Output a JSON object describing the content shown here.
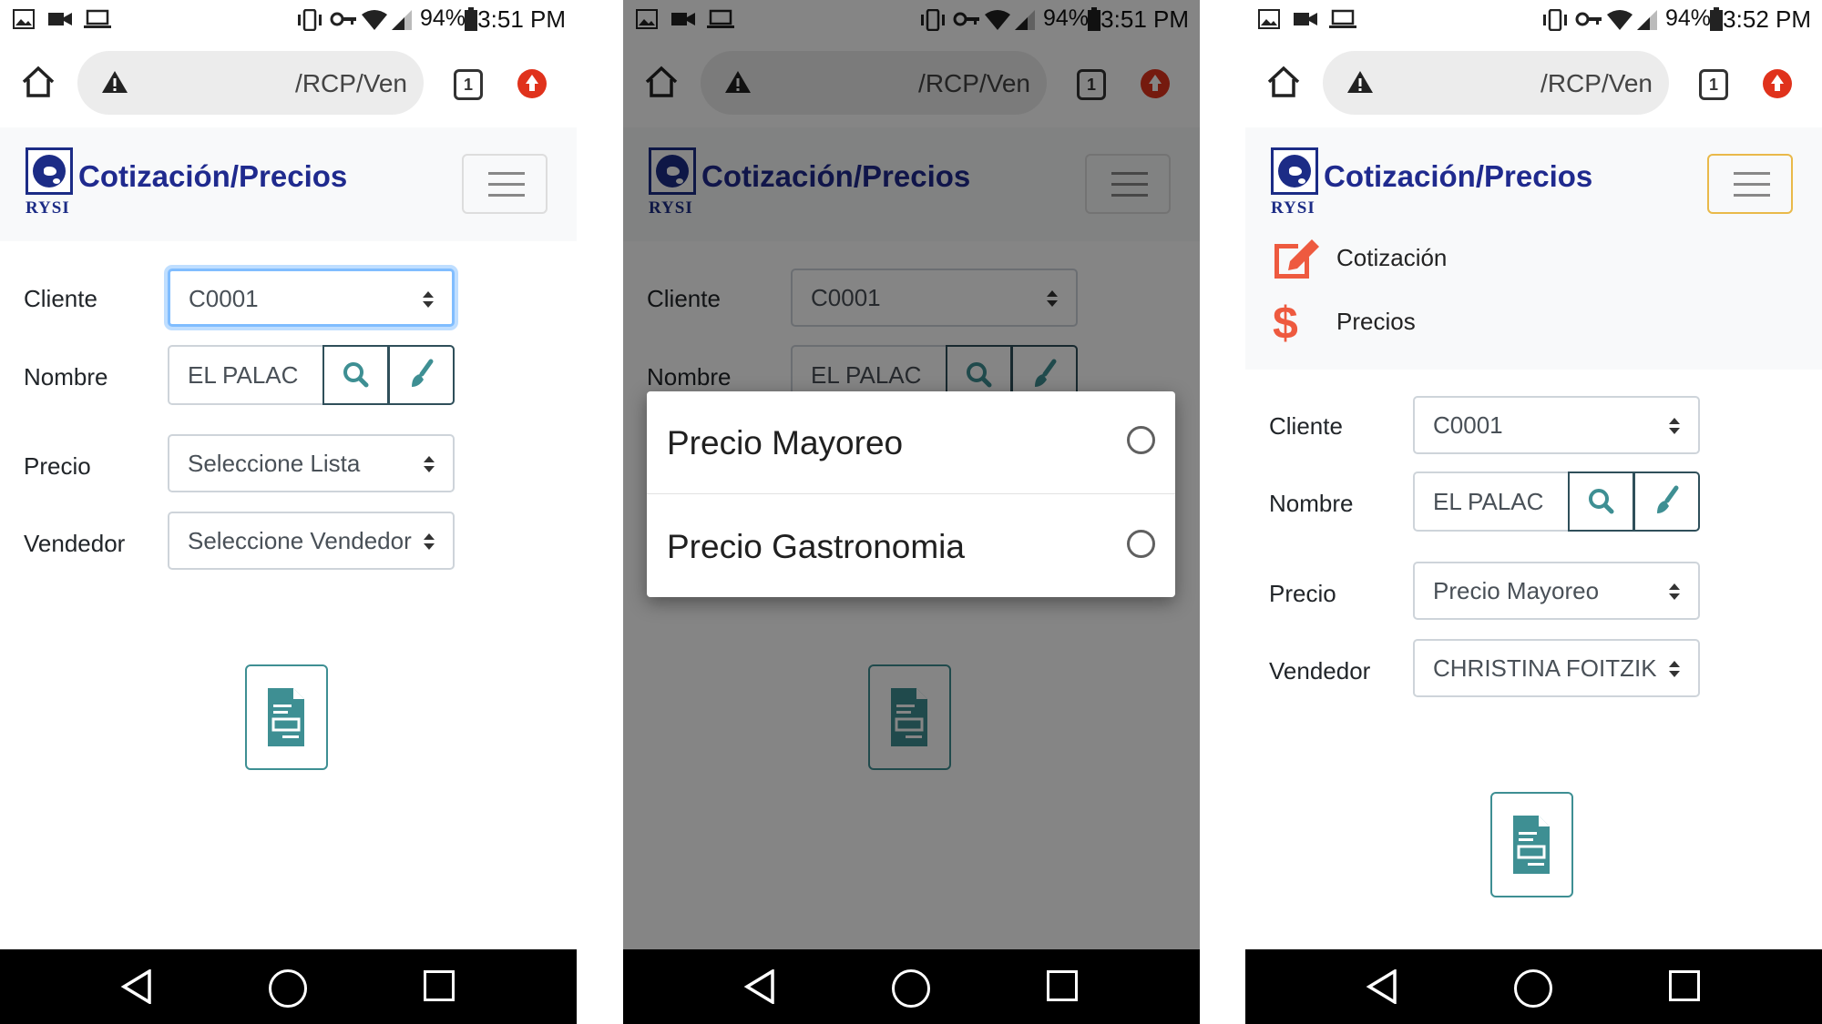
{
  "status_bar": [
    {
      "battery": "94%",
      "time": "3:51 PM"
    },
    {
      "battery": "94%",
      "time": "3:51 PM"
    },
    {
      "battery": "94%",
      "time": "3:52 PM"
    }
  ],
  "browser": {
    "url_text": "/RCP/Ven",
    "tab_count": "1"
  },
  "app": {
    "logo_text": "RYSI",
    "brand_title": "Cotización/Precios"
  },
  "menu": {
    "items": [
      {
        "label": "Cotización",
        "icon": "edit-icon",
        "color": "#ee5a3f"
      },
      {
        "label": "Precios",
        "icon": "dollar-icon",
        "color": "#ee5a3f"
      }
    ]
  },
  "form": {
    "labels": {
      "cliente": "Cliente",
      "nombre": "Nombre",
      "precio": "Precio",
      "vendedor": "Vendedor"
    },
    "before": {
      "cliente": "C0001",
      "nombre": "EL PALAC",
      "precio": "Seleccione Lista",
      "vendedor": "Seleccione Vendedor"
    },
    "after": {
      "cliente": "C0001",
      "nombre": "EL PALAC",
      "precio": "Precio Mayoreo",
      "vendedor": "CHRISTINA FOITZIK"
    }
  },
  "dialog": {
    "options": [
      "Precio Mayoreo",
      "Precio Gastronomia"
    ]
  },
  "colors": {
    "brand": "#1f2a8e",
    "accent_teal": "#3e8f93",
    "menu_icon": "#ee5a3f",
    "focus_outline": "#80bdff"
  }
}
